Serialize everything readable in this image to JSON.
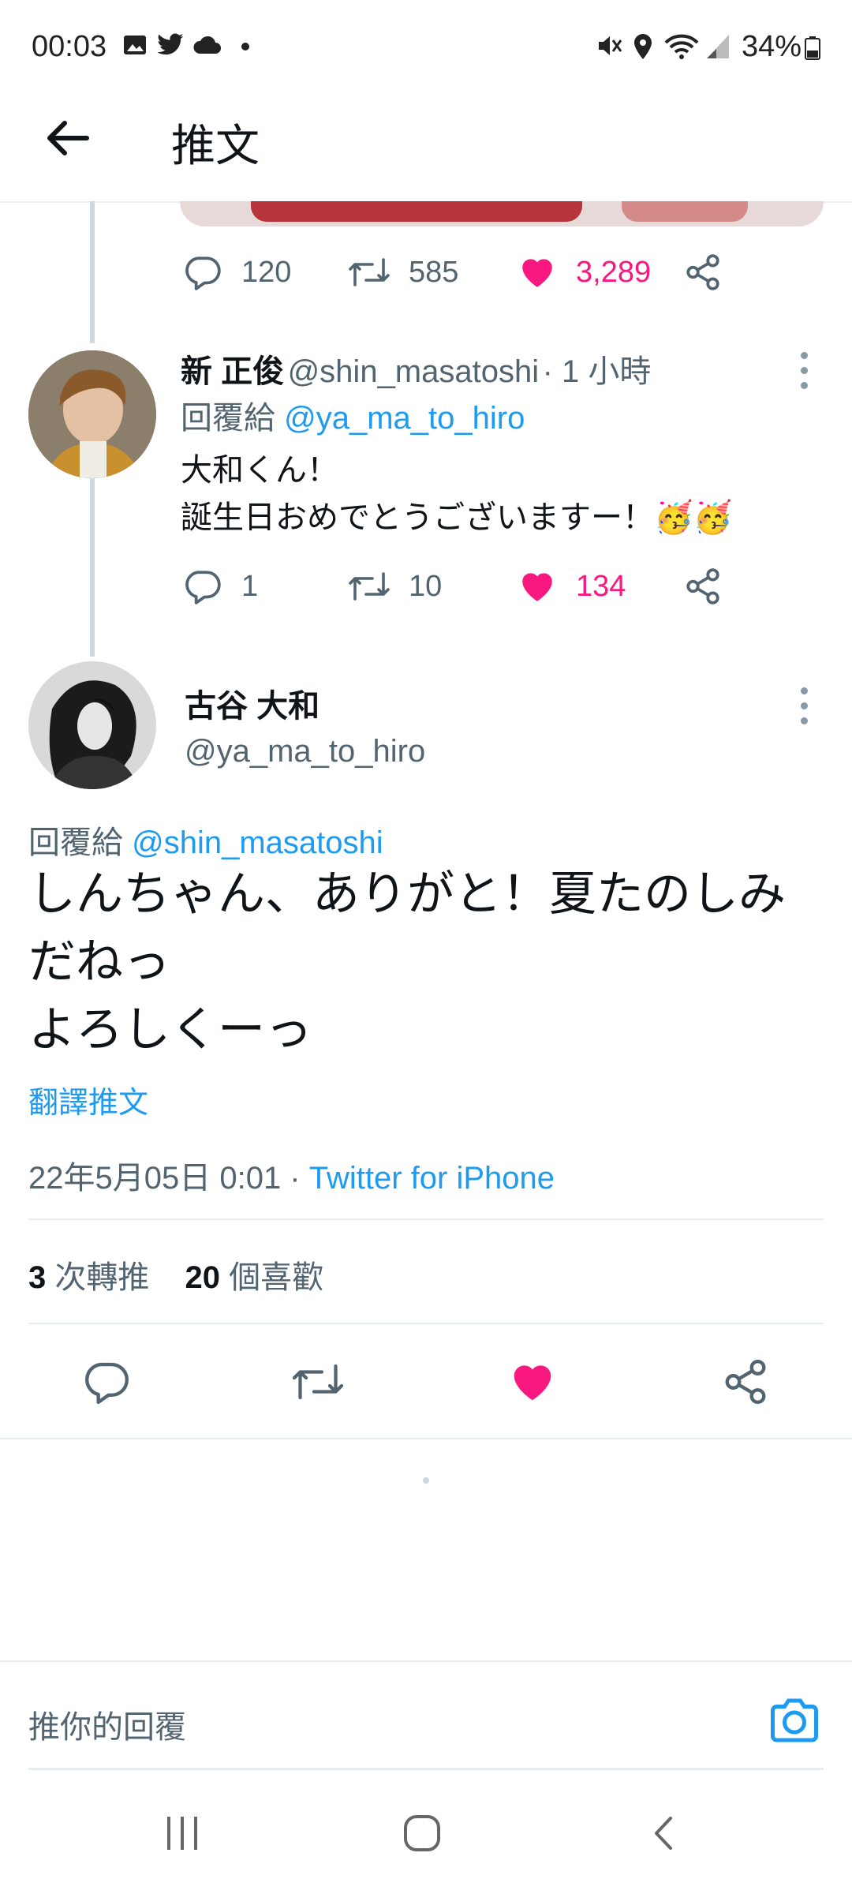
{
  "status_bar": {
    "time": "00:03",
    "battery": "34%"
  },
  "header": {
    "title": "推文"
  },
  "prev_tweet": {
    "reply_count": "120",
    "retweet_count": "585",
    "like_count": "3,289"
  },
  "reply_tweet": {
    "name": "新 正俊",
    "handle": "@shin_masatoshi",
    "time": "· 1 小時",
    "replying_prefix": "回覆給",
    "replying_to": "@ya_ma_to_hiro",
    "line1": "大和くん！",
    "line2": "誕生日おめでとうございますー！🥳🥳",
    "reply_count": "1",
    "retweet_count": "10",
    "like_count": "134"
  },
  "main_tweet": {
    "name": "古谷 大和",
    "handle": "@ya_ma_to_hiro",
    "replying_prefix": "回覆給",
    "replying_to": "@shin_masatoshi",
    "line1": "しんちゃん、ありがと！夏たのしみ",
    "line2": "だねっ",
    "line3": "よろしくーっ",
    "translate": "翻譯推文",
    "datetime": "22年5月05日 0:01 · ",
    "source": "Twitter for iPhone",
    "retweets_num": "3",
    "retweets_label": "次轉推",
    "likes_num": "20",
    "likes_label": "個喜歡"
  },
  "compose": {
    "placeholder": "推你的回覆"
  },
  "colors": {
    "link": "#1d9bf0",
    "like": "#f91880",
    "muted": "#536471"
  }
}
